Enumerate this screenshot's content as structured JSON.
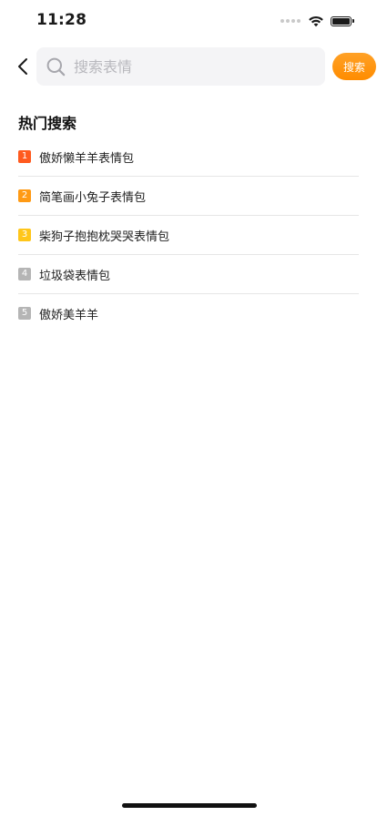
{
  "status_bar": {
    "time": "11:28"
  },
  "header": {
    "back_icon": "chevron-left-icon",
    "search_placeholder": "搜索表情",
    "search_value": "",
    "search_button_label": "搜索"
  },
  "hot_search": {
    "title": "热门搜索",
    "items": [
      {
        "rank": "1",
        "label": "傲娇懒羊羊表情包",
        "badge_color": "#ff5a1f"
      },
      {
        "rank": "2",
        "label": "简笔画小兔子表情包",
        "badge_color": "#ff9a14"
      },
      {
        "rank": "3",
        "label": "柴狗子抱抱枕哭哭表情包",
        "badge_color": "#ffc61a"
      },
      {
        "rank": "4",
        "label": "垃圾袋表情包",
        "badge_color": "#b5b5b5"
      },
      {
        "rank": "5",
        "label": "傲娇美羊羊",
        "badge_color": "#b5b5b5"
      }
    ]
  },
  "colors": {
    "accent": "#ff9500",
    "search_bg": "#f4f4f6",
    "placeholder": "#b8b8bd",
    "divider": "#e6e6e6"
  }
}
